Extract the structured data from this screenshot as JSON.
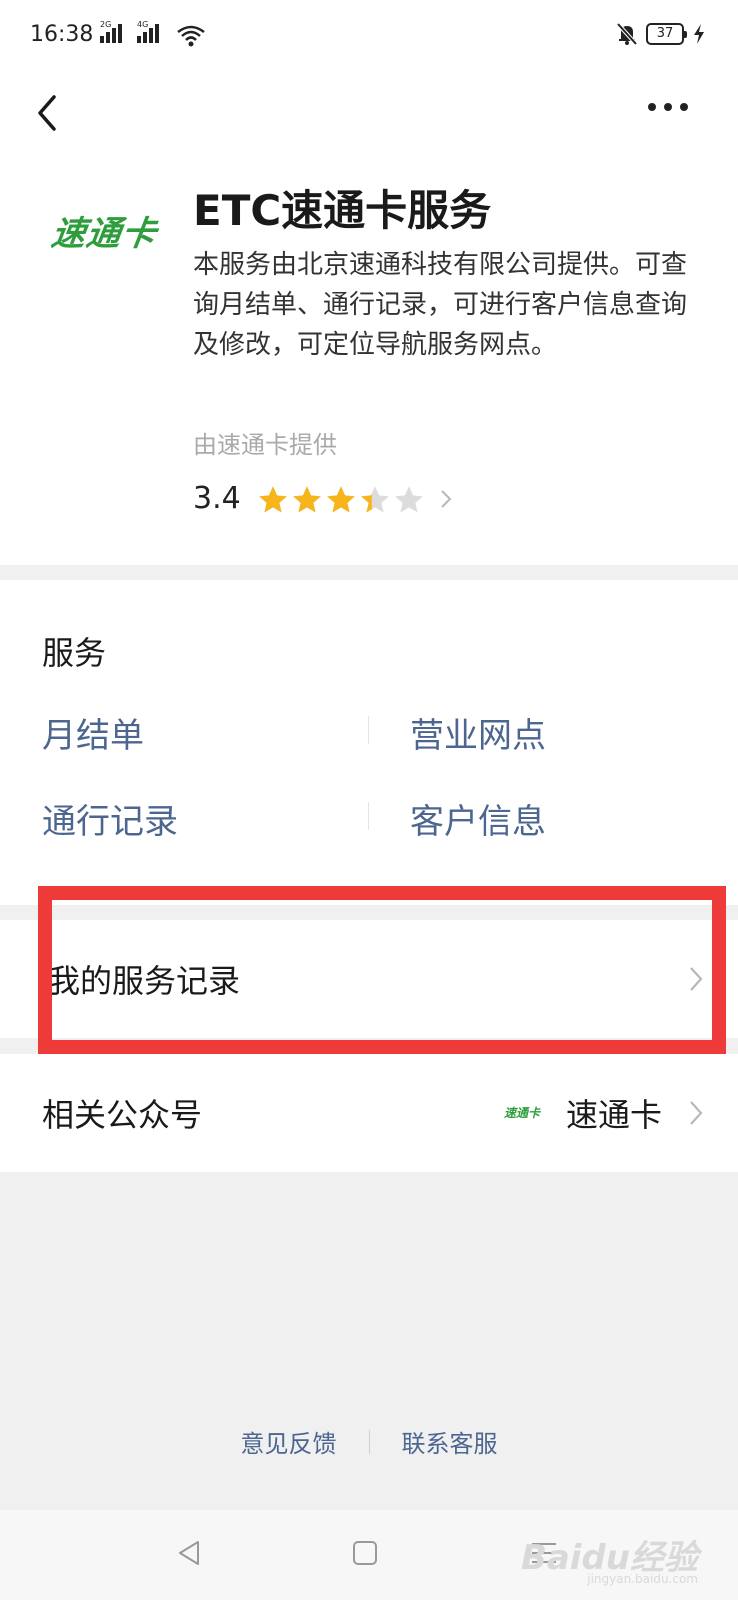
{
  "status_bar": {
    "time": "16:38",
    "signal1_tag": "2G",
    "signal2_tag": "4G",
    "battery": "37"
  },
  "app": {
    "logo_text": "速通卡",
    "title": "ETC速通卡服务",
    "description": "本服务由北京速通科技有限公司提供。可查询月结单、通行记录，可进行客户信息查询及修改，可定位导航服务网点。",
    "provider": "由速通卡提供",
    "rating": "3.4",
    "rating_value": 3.4,
    "rating_max": 5
  },
  "services": {
    "title": "服务",
    "items": [
      {
        "label": "月结单"
      },
      {
        "label": "营业网点"
      },
      {
        "label": "通行记录"
      },
      {
        "label": "客户信息"
      }
    ]
  },
  "record": {
    "label": "我的服务记录"
  },
  "related": {
    "label": "相关公众号",
    "logo_text": "速通卡",
    "value": "速通卡"
  },
  "footer": {
    "feedback": "意见反馈",
    "contact": "联系客服"
  },
  "watermark": {
    "text": "Baidu经验",
    "sub": "jingyan.baidu.com"
  },
  "colors": {
    "brand_green": "#2e9e3c",
    "link_blue": "#4c6690",
    "star_gold": "#f7b51c",
    "highlight_red": "#ef3a3a"
  },
  "icons": {
    "back": "chevron-left-icon",
    "more": "more-dots-icon",
    "chevron": "chevron-right-icon",
    "wifi": "wifi-icon",
    "bell_off": "bell-off-icon",
    "charging": "charging-bolt-icon",
    "nav_back": "nav-back-icon",
    "nav_home": "nav-home-icon",
    "nav_menu": "nav-menu-icon"
  }
}
